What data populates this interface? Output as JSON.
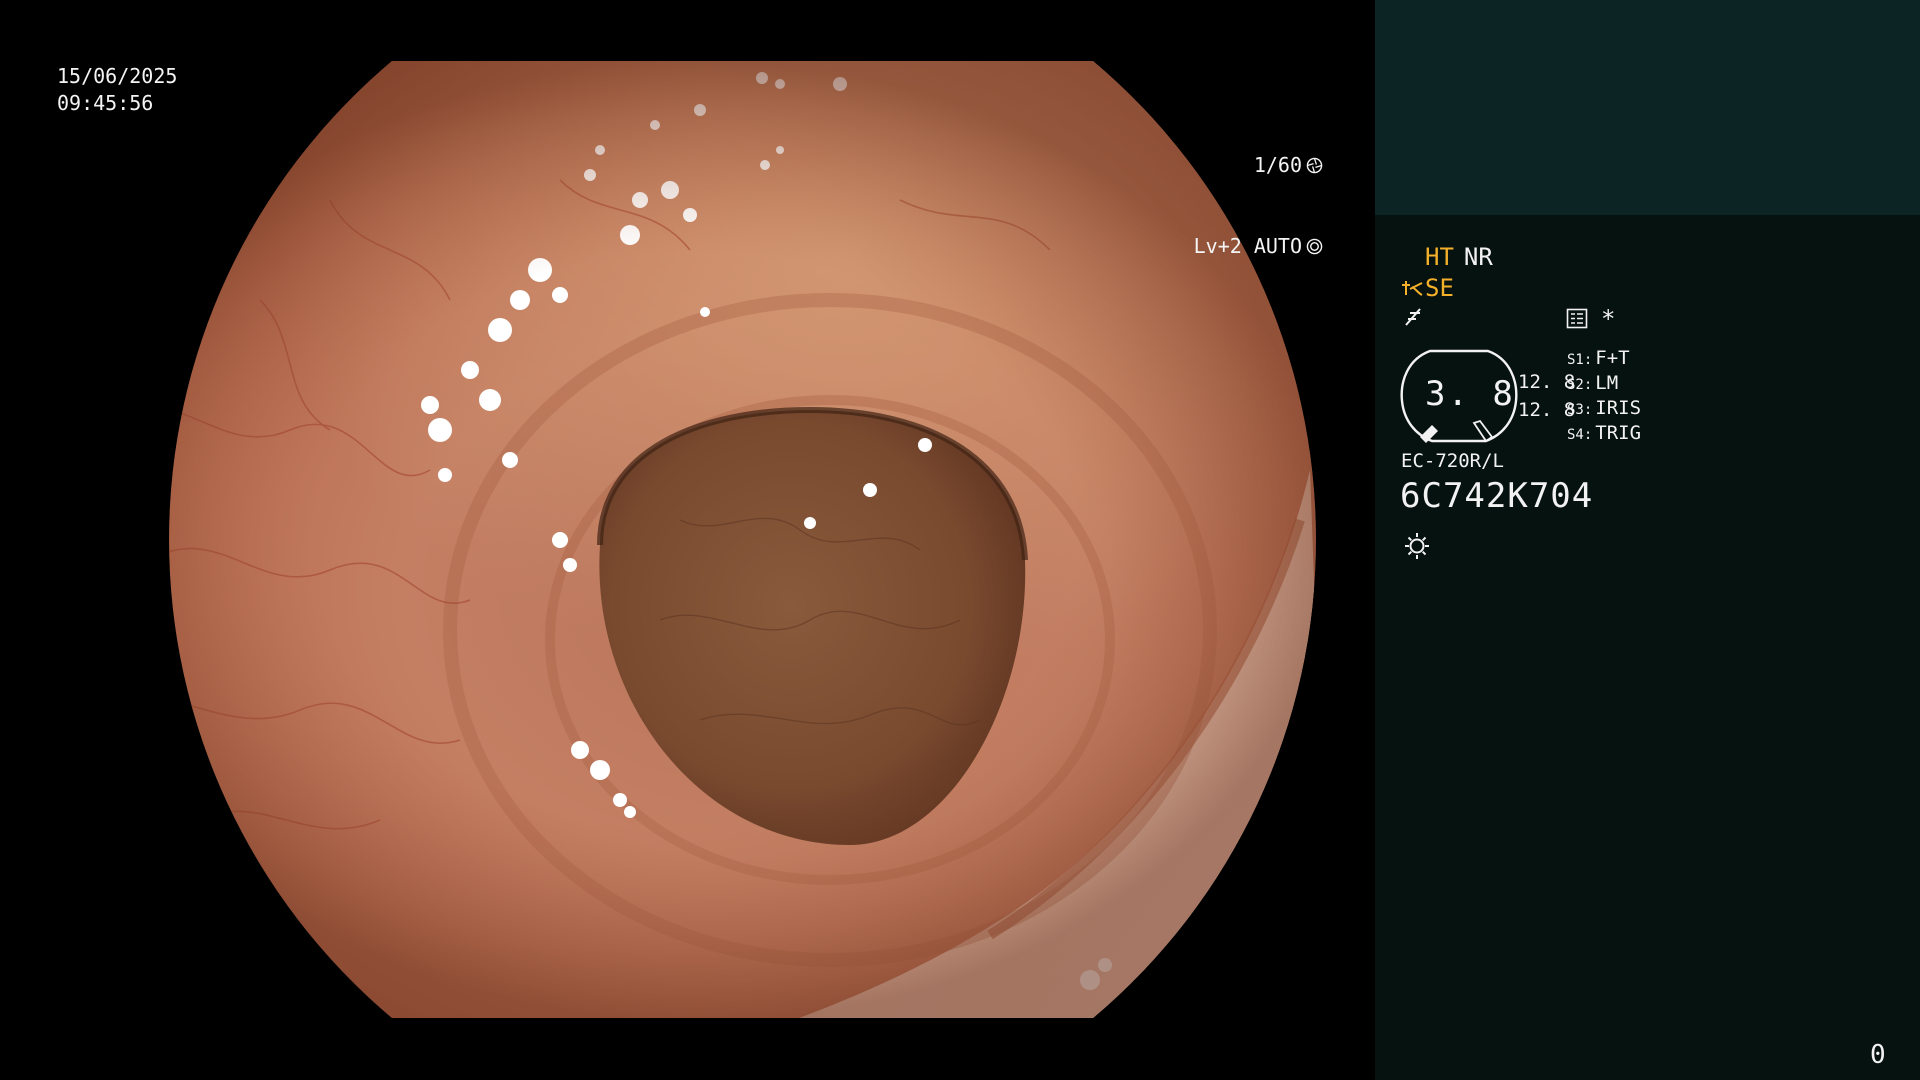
{
  "scope": {
    "date": "15/06/2025",
    "time": "09:45:56",
    "shutter": "1/60",
    "exposure": "Lv+2 AUTO",
    "shutter_icon": "aperture-icon",
    "exposure_icon": "iris-auto-icon"
  },
  "panel": {
    "mode_ht": "HT",
    "mode_nr": "NR",
    "se_label": "SE",
    "se_icon": "structure-enhance-icon",
    "freeze_icon": "freeze-icon",
    "menu_icon": "menu-list-icon",
    "asterisk": "*",
    "gauge_value": "3. 8",
    "value_a": "12. 8",
    "value_b": "12. 8",
    "switches": [
      {
        "key": "S1:",
        "value": "F+T"
      },
      {
        "key": "S2:",
        "value": "LM"
      },
      {
        "key": "S3:",
        "value": "IRIS"
      },
      {
        "key": "S4:",
        "value": "TRIG"
      }
    ],
    "model": "EC-720R/L",
    "serial": "6C742K704",
    "light_icon": "light-source-icon",
    "counter": "0"
  },
  "colors": {
    "panel_bg": "#06120f",
    "panel_top_bg": "#0d2424",
    "accent_amber": "#f4b02a",
    "text": "#f2f2f2"
  }
}
